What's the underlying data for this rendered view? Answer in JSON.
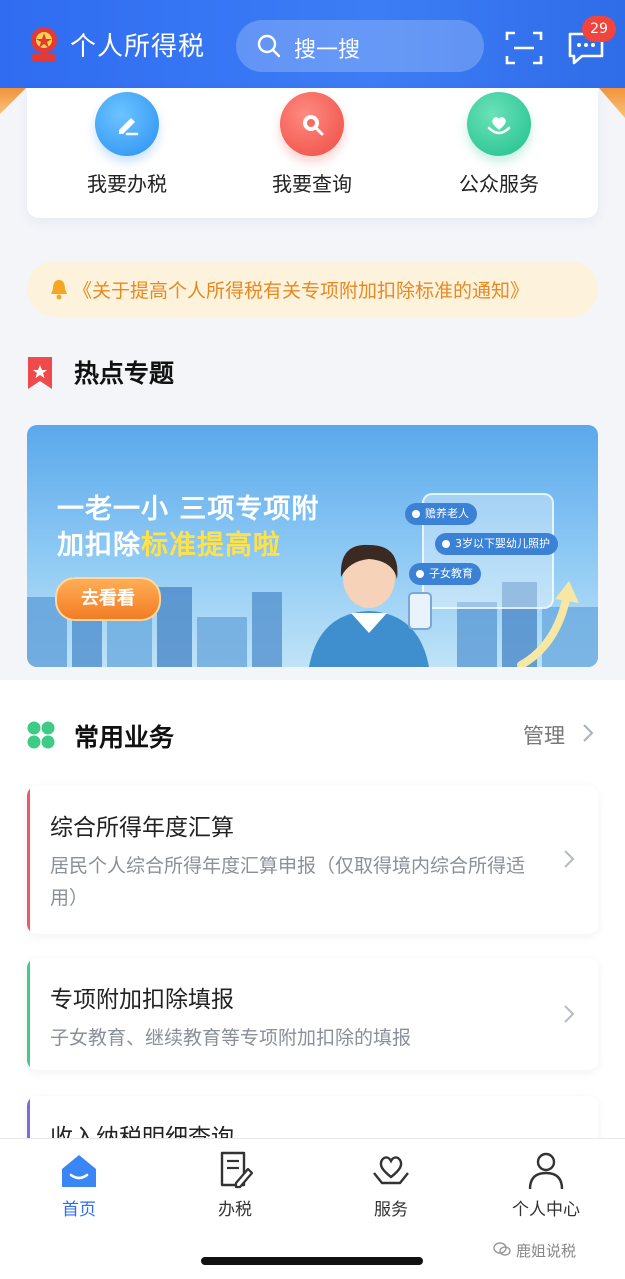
{
  "header": {
    "app_title": "个人所得税",
    "search_placeholder": "搜一搜",
    "message_count": "29"
  },
  "quick_actions": [
    {
      "label": "我要办税",
      "icon": "edit-icon",
      "color": "#2a8ff2"
    },
    {
      "label": "我要查询",
      "icon": "search-icon",
      "color": "#ee4b43"
    },
    {
      "label": "公众服务",
      "icon": "heart-hand-icon",
      "color": "#1fbf8d"
    }
  ],
  "notice": {
    "text": "《关于提高个人所得税有关专项附加扣除标准的通知》"
  },
  "hot_topics": {
    "title": "热点专题",
    "banner": {
      "line1": "一老一小 三项专项附",
      "line2_prefix": "加扣除",
      "line2_highlight": "标准提高啦",
      "button": "去看看",
      "chips": [
        "赡养老人",
        "3岁以下婴幼儿照护",
        "子女教育"
      ]
    }
  },
  "common_business": {
    "title": "常用业务",
    "manage_label": "管理",
    "items": [
      {
        "title": "综合所得年度汇算",
        "desc": "居民个人综合所得年度汇算申报（仅取得境内综合所得适用）",
        "accent": "#f0556a"
      },
      {
        "title": "专项附加扣除填报",
        "desc": "子女教育、继续教育等专项附加扣除的填报",
        "accent": "#43c98a"
      },
      {
        "title": "收入纳税明细查询",
        "desc": "",
        "accent": "#7b6be0"
      }
    ]
  },
  "tabbar": {
    "items": [
      {
        "label": "首页",
        "active": true
      },
      {
        "label": "办税",
        "active": false
      },
      {
        "label": "服务",
        "active": false
      },
      {
        "label": "个人中心",
        "active": false
      }
    ]
  },
  "watermark": "鹿姐说税",
  "colors": {
    "primary": "#2f6cf1",
    "notice_text": "#e9881f",
    "badge": "#f0443c"
  }
}
